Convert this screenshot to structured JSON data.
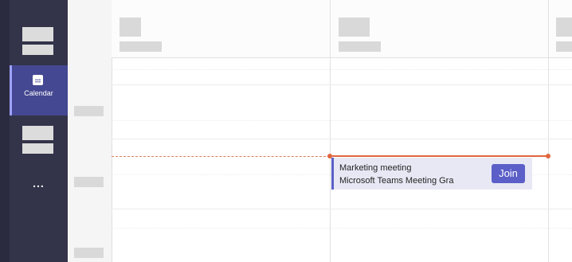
{
  "app_bar": {
    "calendar_label": "Calendar",
    "more_label": "...",
    "accent_color": "#444791"
  },
  "event": {
    "title": "Marketing meeting",
    "subtitle": "Microsoft Teams Meeting Gra",
    "join_label": "Join",
    "accent_color": "#5b5fc7"
  },
  "current_time_indicator_color": "#e0663f"
}
